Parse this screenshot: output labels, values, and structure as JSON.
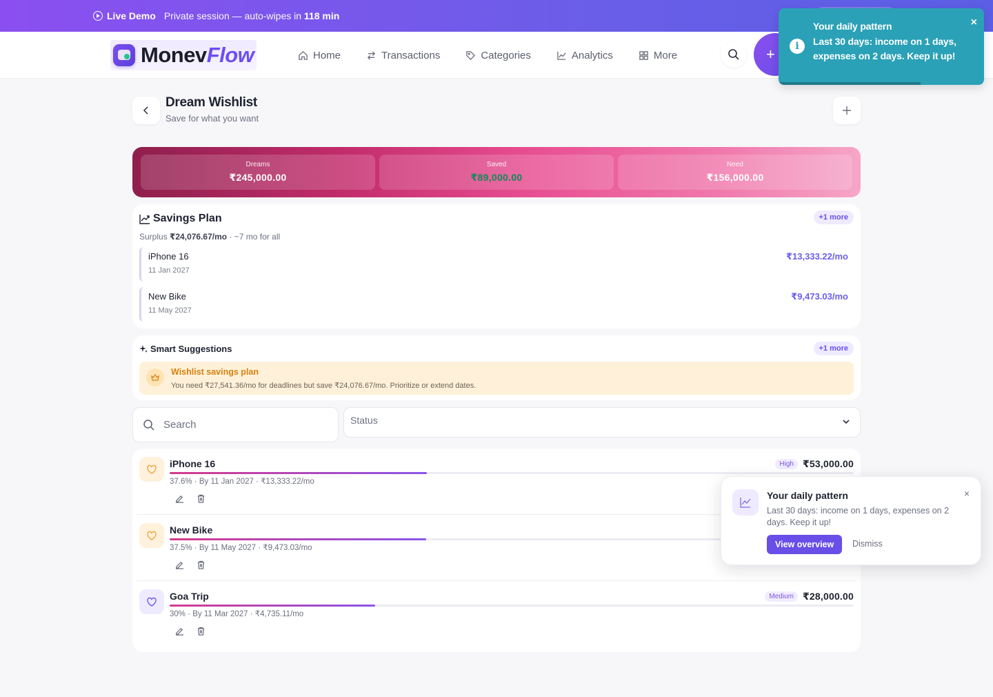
{
  "demo": {
    "live_label": "Live Demo",
    "session_text": "Private session — auto-wipes in",
    "minutes": "118 min"
  },
  "brand": {
    "name_a": "Monev",
    "name_b": "Flow"
  },
  "nav": {
    "items": [
      {
        "label": "Home",
        "icon": "home-icon"
      },
      {
        "label": "Transactions",
        "icon": "transfer-icon"
      },
      {
        "label": "Categories",
        "icon": "tag-icon"
      },
      {
        "label": "Analytics",
        "icon": "chart-line-icon"
      },
      {
        "label": "More",
        "icon": "grid-icon"
      }
    ],
    "add_label": "+"
  },
  "page": {
    "title": "Dream Wishlist",
    "subtitle": "Save for what you want"
  },
  "stats": [
    {
      "label": "Dreams",
      "value": "₹245,000.00"
    },
    {
      "label": "Saved",
      "value": "₹89,000.00"
    },
    {
      "label": "Need",
      "value": "₹156,000.00"
    }
  ],
  "savings_plan": {
    "title": "Savings Plan",
    "more": "+1 more",
    "surplus_prefix": "Surplus",
    "surplus_value": "₹24,076.67/mo",
    "surplus_suffix": "· ~7 mo for all",
    "rows": [
      {
        "name": "iPhone 16",
        "date": "11 Jan 2027",
        "amount": "₹13,333.22/mo"
      },
      {
        "name": "New Bike",
        "date": "11 May 2027",
        "amount": "₹9,473.03/mo"
      }
    ]
  },
  "suggestions": {
    "title": "Smart Suggestions",
    "more": "+1 more",
    "tip_title": "Wishlist savings plan",
    "tip_text": "You need ₹27,541.36/mo for deadlines but save ₹24,076.67/mo. Prioritize or extend dates."
  },
  "filters": {
    "search_placeholder": "Search",
    "status_label": "Status"
  },
  "wishes": [
    {
      "name": "iPhone 16",
      "progress": 0.376,
      "meta": "37.6% · By 11 Jan 2027 · ₹13,333.22/mo",
      "priority": "High",
      "amount": "₹53,000.00",
      "heart_color": "#f0a640",
      "heart_bg": "#fff1dc"
    },
    {
      "name": "New Bike",
      "progress": 0.375,
      "meta": "37.5% · By 11 May 2027 · ₹9,473.03/mo",
      "priority": "",
      "amount": "",
      "heart_color": "#f0a640",
      "heart_bg": "#fff1dc"
    },
    {
      "name": "Goa Trip",
      "progress": 0.3,
      "meta": "30% · By 11 Mar 2027 · ₹4,735.11/mo",
      "priority": "Medium",
      "amount": "₹28,000.00",
      "heart_color": "#6a5ee8",
      "heart_bg": "#eeeaff"
    }
  ],
  "toast": {
    "title": "Your daily pattern",
    "message": "Last 30 days: income on 1 days, expenses on 2 days. Keep it up!",
    "close": "×"
  },
  "popup": {
    "title": "Your daily pattern",
    "message": "Last 30 days: income on 1 days, expenses on 2 days. Keep it up!",
    "primary": "View overview",
    "secondary": "Dismiss",
    "close": "×"
  },
  "colors": {
    "accent": "#6a4ee8",
    "toast_bg": "#2aa1b7",
    "tip_bg": "#fff1d9"
  }
}
